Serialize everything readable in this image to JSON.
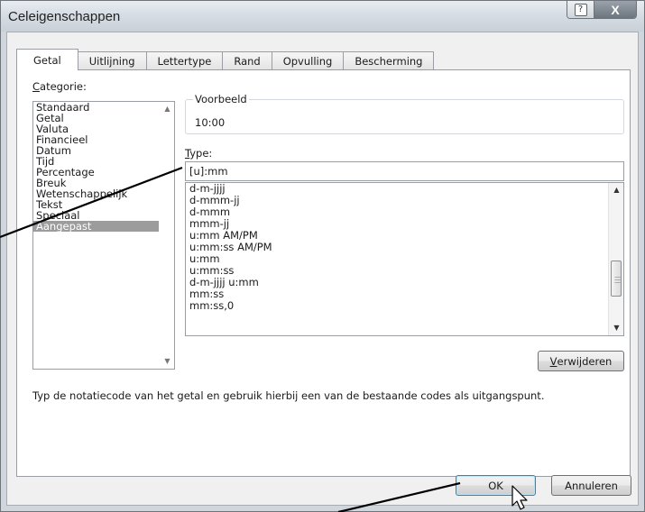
{
  "window": {
    "title": "Celeigenschappen"
  },
  "title_buttons": {
    "help_glyph": "?",
    "close_glyph": "X"
  },
  "tabs": [
    {
      "label": "Getal",
      "active": true
    },
    {
      "label": "Uitlijning"
    },
    {
      "label": "Lettertype"
    },
    {
      "label": "Rand"
    },
    {
      "label": "Opvulling"
    },
    {
      "label": "Bescherming"
    }
  ],
  "category": {
    "label_accel": "C",
    "label_rest": "ategorie:",
    "items": [
      "Standaard",
      "Getal",
      "Valuta",
      "Financieel",
      "Datum",
      "Tijd",
      "Percentage",
      "Breuk",
      "Wetenschappelijk",
      "Tekst",
      "Speciaal",
      "Aangepast"
    ],
    "selected": "Aangepast"
  },
  "preview": {
    "legend": "Voorbeeld",
    "value": "10:00"
  },
  "type": {
    "label_accel": "T",
    "label_rest": "ype:",
    "input_value": "[u]:mm",
    "list": [
      "d-m-jjjj",
      "d-mmm-jj",
      "d-mmm",
      "mmm-jj",
      "u:mm AM/PM",
      "u:mm:ss AM/PM",
      "u:mm",
      "u:mm:ss",
      "d-m-jjjj u:mm",
      "mm:ss",
      "mm:ss,0"
    ]
  },
  "delete_button": {
    "accel": "V",
    "rest": "erwijderen"
  },
  "hint": "Typ de notatiecode van het getal en gebruik hierbij een van de bestaande codes als uitgangspunt.",
  "footer": {
    "ok_label": "OK",
    "cancel_label": "Annuleren"
  },
  "colors": {
    "selection": "#9c9c9c",
    "titlebar": "#d5dce3",
    "dialog_bg": "#f0f0f0",
    "ok_border": "#3c7fb1"
  },
  "icons": {
    "list_up": "triangle-up",
    "list_down": "triangle-down",
    "pointer": "mouse-pointer"
  }
}
